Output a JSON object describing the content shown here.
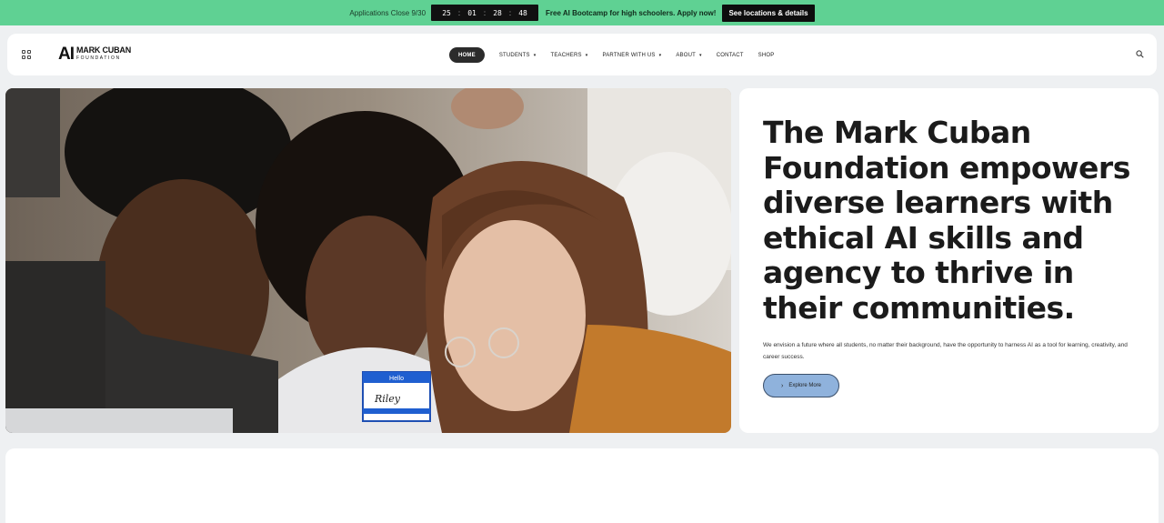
{
  "topbar": {
    "close_text": "Applications Close 9/30",
    "countdown": [
      "25",
      "01",
      "28",
      "48"
    ],
    "promo": "Free AI Bootcamp for high schoolers. Apply now!",
    "details_button": "See locations & details",
    "bg_color": "#5fd193"
  },
  "header": {
    "logo": {
      "mark": "AI",
      "line1": "MARK CUBAN",
      "line2": "FOUNDATION"
    },
    "nav": [
      {
        "label": "HOME",
        "active": true
      },
      {
        "label": "STUDENTS",
        "caret": true
      },
      {
        "label": "TEACHERS",
        "caret": true
      },
      {
        "label": "PARTNER WITH US",
        "caret": true
      },
      {
        "label": "ABOUT",
        "caret": true
      },
      {
        "label": "CONTACT"
      },
      {
        "label": "SHOP"
      }
    ],
    "icons": {
      "menu": "grid-icon",
      "search": "search-icon"
    }
  },
  "hero": {
    "title": "The Mark Cuban Foundation empowers diverse learners with ethical AI skills and agency to thrive in their communities.",
    "description": "We envision a future where all students, no matter their background, have the opportunity to harness AI as a tool for learning, creativity, and career success.",
    "button": "Explore More",
    "button_color": "#8fb2dc",
    "name_tag": {
      "line1": "Hello",
      "name": "Riley"
    }
  }
}
